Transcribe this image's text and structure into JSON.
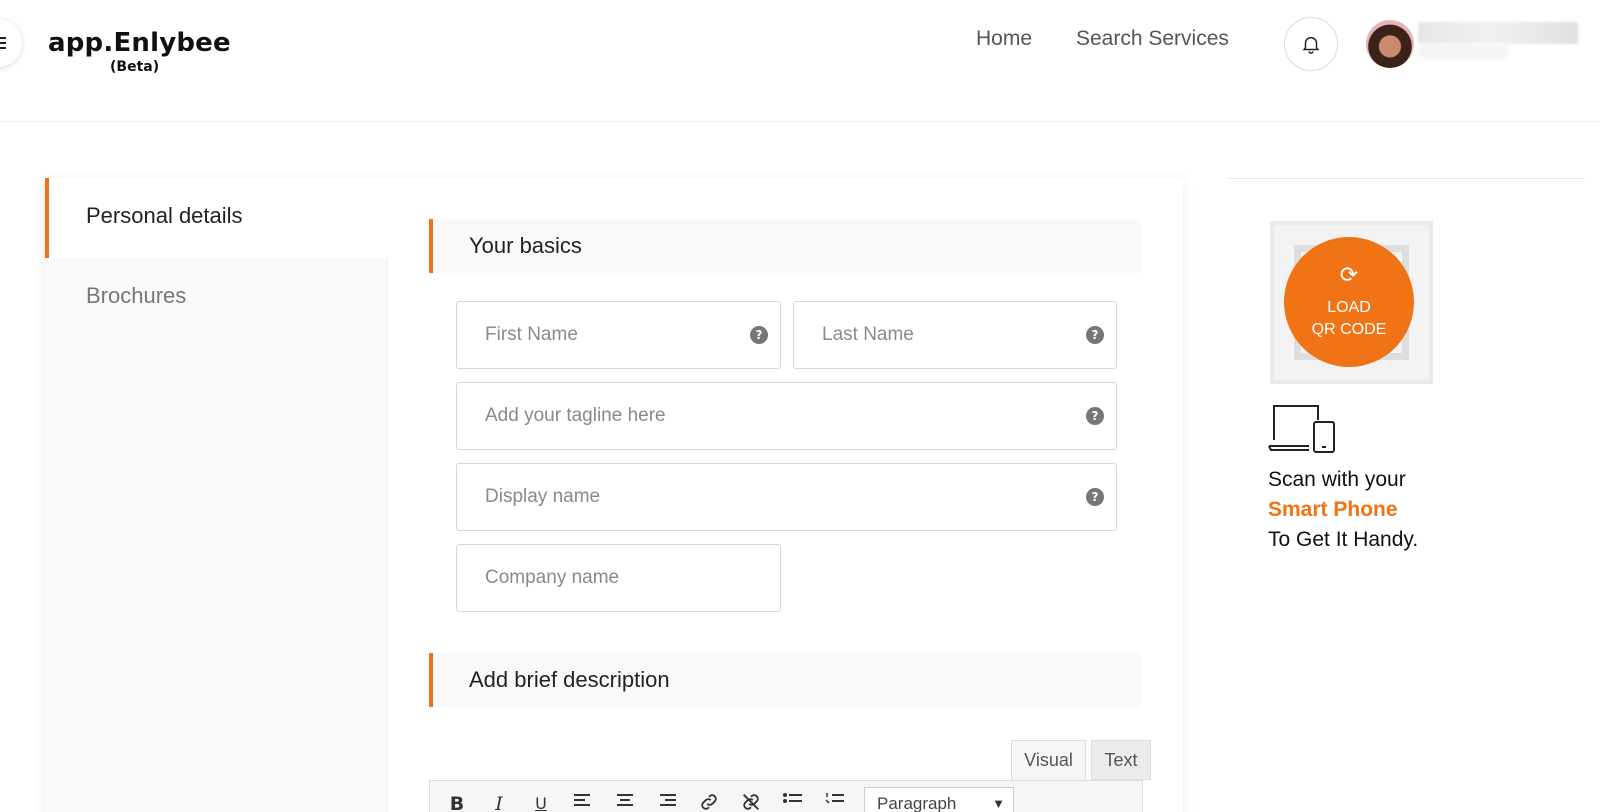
{
  "header": {
    "logo_main": "app.Enlybee",
    "logo_sub": "(Beta)",
    "nav": {
      "home": "Home",
      "search_services": "Search Services"
    }
  },
  "sidebar": {
    "items": [
      {
        "label": "Personal details",
        "active": true
      },
      {
        "label": "Brochures",
        "active": false
      }
    ]
  },
  "main": {
    "section_basics": "Your basics",
    "fields": {
      "first_name": {
        "placeholder": "First Name",
        "value": ""
      },
      "last_name": {
        "placeholder": "Last Name",
        "value": ""
      },
      "tagline": {
        "placeholder": "Add your tagline here",
        "value": ""
      },
      "display_name": {
        "placeholder": "Display name",
        "value": ""
      },
      "company_name": {
        "placeholder": "Company name",
        "value": ""
      }
    },
    "section_description": "Add brief description",
    "editor": {
      "tabs": [
        "Visual",
        "Text"
      ],
      "format_select": "Paragraph",
      "toolbar": [
        "bold",
        "italic",
        "underline",
        "align-left",
        "align-center",
        "align-right",
        "link",
        "unlink",
        "bulleted-list",
        "numbered-list"
      ]
    }
  },
  "right_panel": {
    "qr_button_line1": "LOAD",
    "qr_button_line2": "QR CODE",
    "scan_line1": "Scan with your",
    "scan_highlight": "Smart Phone",
    "scan_line3": "To Get It Handy."
  },
  "colors": {
    "accent": "#f07316"
  }
}
